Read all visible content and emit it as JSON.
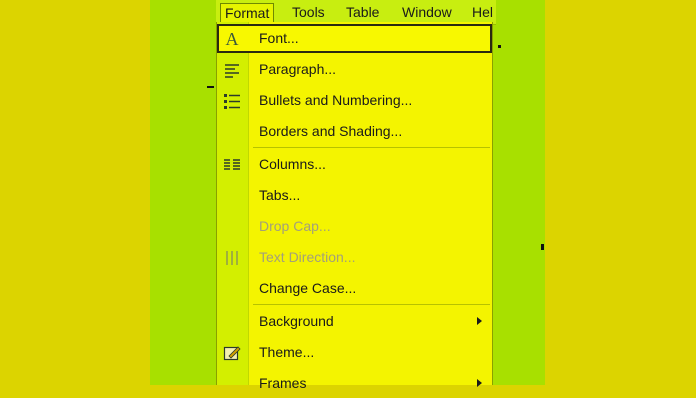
{
  "menubar": {
    "items": [
      {
        "label": "Format",
        "active": true
      },
      {
        "label": "Tools",
        "active": false
      },
      {
        "label": "Table",
        "active": false
      },
      {
        "label": "Window",
        "active": false
      },
      {
        "label": "Hel",
        "active": false
      }
    ]
  },
  "format_menu": {
    "items": [
      {
        "label": "Font...",
        "icon": "font-A-icon",
        "selected": true,
        "disabled": false
      },
      {
        "label": "Paragraph...",
        "icon": "paragraph-icon",
        "disabled": false
      },
      {
        "label": "Bullets and Numbering...",
        "icon": "bullets-icon",
        "disabled": false
      },
      {
        "label": "Borders and Shading...",
        "icon": "",
        "disabled": false
      },
      {
        "label": "Columns...",
        "icon": "columns-icon",
        "disabled": false
      },
      {
        "label": "Tabs...",
        "icon": "",
        "disabled": false
      },
      {
        "label": "Drop Cap...",
        "icon": "",
        "disabled": true
      },
      {
        "label": "Text Direction...",
        "icon": "text-direction-icon",
        "disabled": true
      },
      {
        "label": "Change Case...",
        "icon": "",
        "disabled": false
      },
      {
        "label": "Background",
        "icon": "",
        "disabled": false,
        "submenu": true
      },
      {
        "label": "Theme...",
        "icon": "theme-icon",
        "disabled": false
      },
      {
        "label": "Frames",
        "icon": "",
        "disabled": false,
        "submenu": true
      }
    ]
  },
  "colors": {
    "background": "#dcd400",
    "panel": "#a8e000",
    "menu": "#f4f400"
  }
}
